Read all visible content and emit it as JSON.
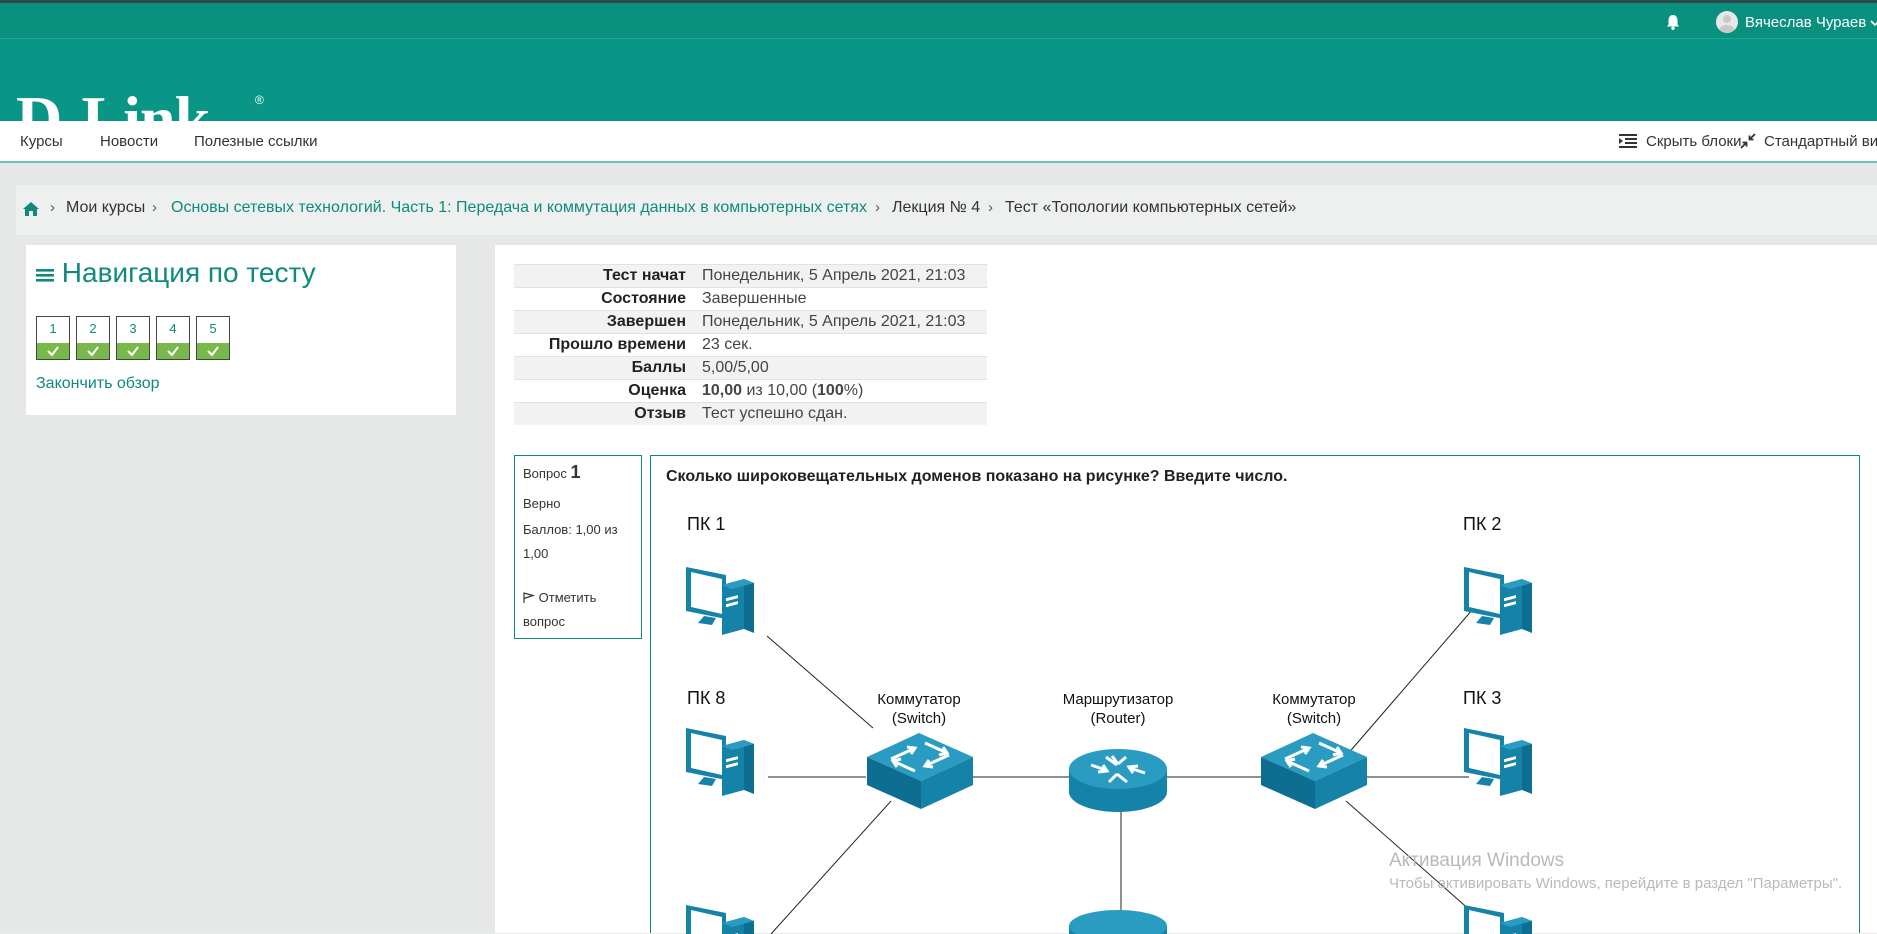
{
  "header": {
    "user_name": "Вячеслав Чураев",
    "logo_text": "D-Link",
    "logo_reg": "®",
    "colors": {
      "teal": "#099687",
      "accent": "#0f8a7c",
      "check_green": "#79b94c"
    }
  },
  "nav": {
    "items": [
      "Курсы",
      "Новости",
      "Полезные ссылки"
    ],
    "hide_blocks": "Скрыть блоки",
    "standard_view": "Стандартный вид"
  },
  "breadcrumb": {
    "items": [
      "Мои курсы",
      "Основы сетевых технологий. Часть 1: Передача и коммутация данных в компьютерных сетях",
      "Лекция № 4",
      "Тест «Топологии компьютерных сетей»"
    ]
  },
  "quiz_nav": {
    "title": "Навигация по тесту",
    "questions": [
      "1",
      "2",
      "3",
      "4",
      "5"
    ],
    "finish_review": "Закончить обзор"
  },
  "summary": [
    {
      "label": "Тест начат",
      "value": "Понедельник, 5 Апрель 2021, 21:03"
    },
    {
      "label": "Состояние",
      "value": "Завершенные"
    },
    {
      "label": "Завершен",
      "value": "Понедельник, 5 Апрель 2021, 21:03"
    },
    {
      "label": "Прошло времени",
      "value": "23 сек."
    },
    {
      "label": "Баллы",
      "value": "5,00/5,00"
    },
    {
      "label": "Оценка",
      "value_bold": "10,00",
      "value_mid": " из 10,00 (",
      "value_bold2": "100",
      "value_end": "%)"
    },
    {
      "label": "Отзыв",
      "value": "Тест успешно сдан."
    }
  ],
  "question": {
    "label": "Вопрос",
    "number": "1",
    "status": "Верно",
    "points": "Баллов: 1,00 из 1,00",
    "flag": "Отметить вопрос",
    "text": "Сколько широковещательных доменов показано на рисунке? Введите число."
  },
  "diagram": {
    "pc1": "ПК 1",
    "pc2": "ПК 2",
    "pc3": "ПК 3",
    "pc8": "ПК 8",
    "switch_left": [
      "Коммутатор",
      "(Switch)"
    ],
    "router": [
      "Маршрутизатор",
      "(Router)"
    ],
    "switch_right": [
      "Коммутатор",
      "(Switch)"
    ]
  },
  "watermark": {
    "line1": "Активация Windows",
    "line2": "Чтобы активировать Windows, перейдите в раздел \"Параметры\"."
  }
}
